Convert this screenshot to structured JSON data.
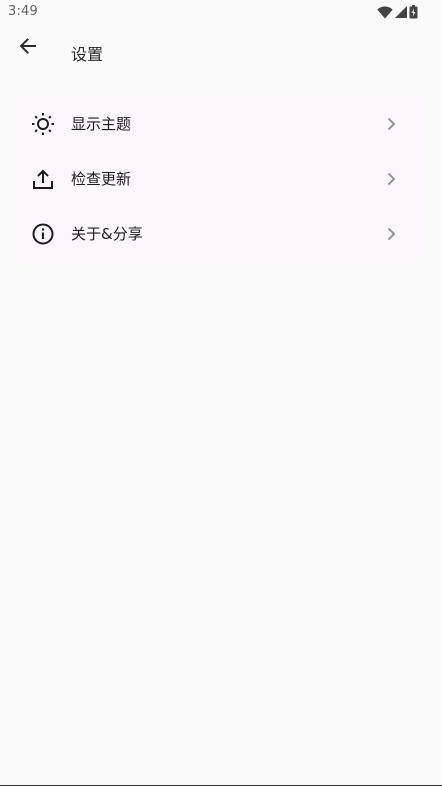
{
  "status_bar": {
    "time": "3:49",
    "icons": [
      "wifi-icon",
      "cellular-signal-icon",
      "battery-charging-icon"
    ]
  },
  "app_bar": {
    "back_icon": "arrow-back-icon",
    "title": "设置"
  },
  "settings": {
    "items": [
      {
        "label": "显示主题",
        "icon": "brightness-icon"
      },
      {
        "label": "检查更新",
        "icon": "upload-icon"
      },
      {
        "label": "关于&分享",
        "icon": "info-icon"
      }
    ]
  },
  "colors": {
    "background": "#fafafa",
    "card": "#fcf6fd",
    "text": "#1c1c1c",
    "secondary_text": "#5f5f5f",
    "chevron": "#8a8a8a"
  }
}
